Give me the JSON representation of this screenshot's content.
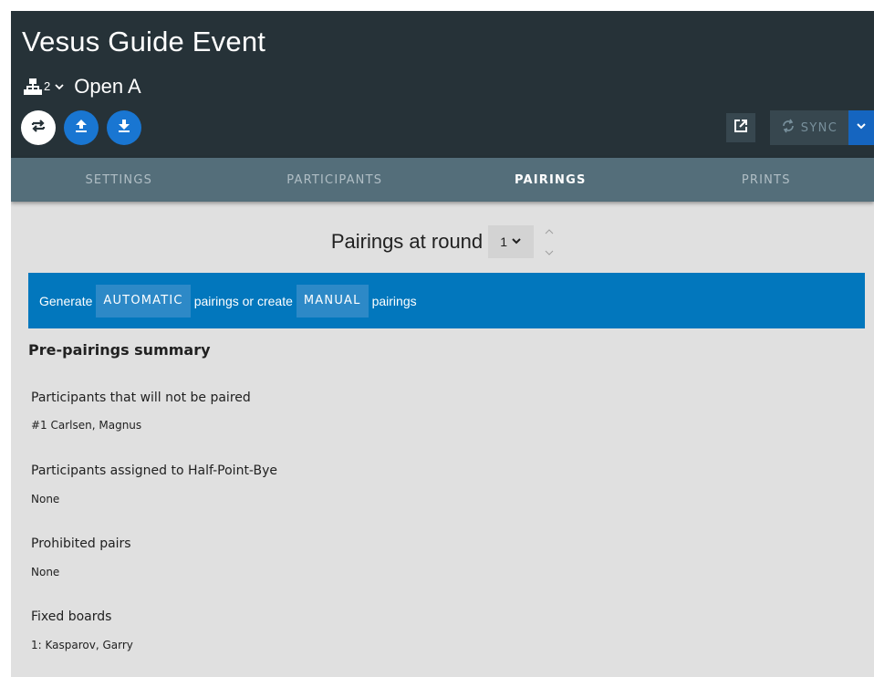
{
  "header": {
    "title": "Vesus Guide Event",
    "tournament_count": "2",
    "tournament_name": "Open A",
    "sync_label": "SYNC"
  },
  "tabs": [
    {
      "label": "SETTINGS",
      "active": false
    },
    {
      "label": "PARTICIPANTS",
      "active": false
    },
    {
      "label": "PAIRINGS",
      "active": true
    },
    {
      "label": "PRINTS",
      "active": false
    }
  ],
  "round": {
    "label": "Pairings at round",
    "value": "1"
  },
  "banner": {
    "text_before": "Generate",
    "automatic_label": "AUTOMATIC",
    "text_middle": "pairings or create",
    "manual_label": "MANUAL",
    "text_after": "pairings"
  },
  "summary": {
    "title": "Pre-pairings summary",
    "sections": [
      {
        "title": "Participants that will not be paired",
        "value": "#1 Carlsen, Magnus"
      },
      {
        "title": "Participants assigned to Half-Point-Bye",
        "value": "None"
      },
      {
        "title": "Prohibited pairs",
        "value": "None"
      },
      {
        "title": "Fixed boards",
        "value": "1: Kasparov, Garry"
      }
    ]
  },
  "colors": {
    "header_bg": "#263238",
    "tabs_bg": "#546e7a",
    "banner_bg": "#0277bd",
    "primary_blue": "#1976d2",
    "content_bg": "#e0e0e0"
  },
  "icons": {
    "tournament": "sitemap-icon",
    "swap": "swap-icon",
    "upload": "upload-icon",
    "download": "download-icon",
    "external": "open-external-icon",
    "sync": "sync-icon"
  }
}
